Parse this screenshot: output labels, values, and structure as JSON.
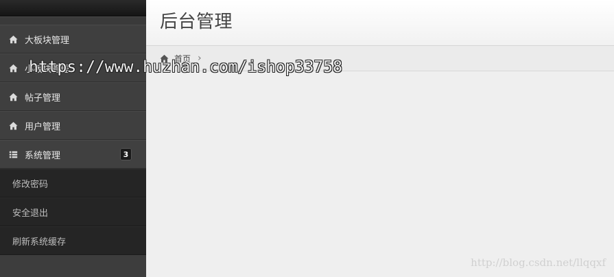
{
  "header": {
    "title": "后台管理"
  },
  "breadcrumb": {
    "home_label": "首页",
    "separator": "›"
  },
  "sidebar": {
    "items": [
      {
        "label": "大板块管理",
        "icon": "home-icon"
      },
      {
        "label": "小板块管理",
        "icon": "home-icon"
      },
      {
        "label": "帖子管理",
        "icon": "home-icon"
      },
      {
        "label": "用户管理",
        "icon": "home-icon"
      },
      {
        "label": "系统管理",
        "icon": "list-icon",
        "badge": "3",
        "expanded": true
      }
    ],
    "submenu": [
      {
        "label": "修改密码"
      },
      {
        "label": "安全退出"
      },
      {
        "label": "刷新系统缓存"
      }
    ]
  },
  "watermarks": {
    "top": "https://www.huzhan.com/ishop33758",
    "bottom": "http://blog.csdn.net/llqqxf"
  },
  "colors": {
    "sidebar_bg": "#3f3f3f",
    "submenu_bg": "#252525",
    "main_bg": "#efefef",
    "title_text": "#444444"
  }
}
